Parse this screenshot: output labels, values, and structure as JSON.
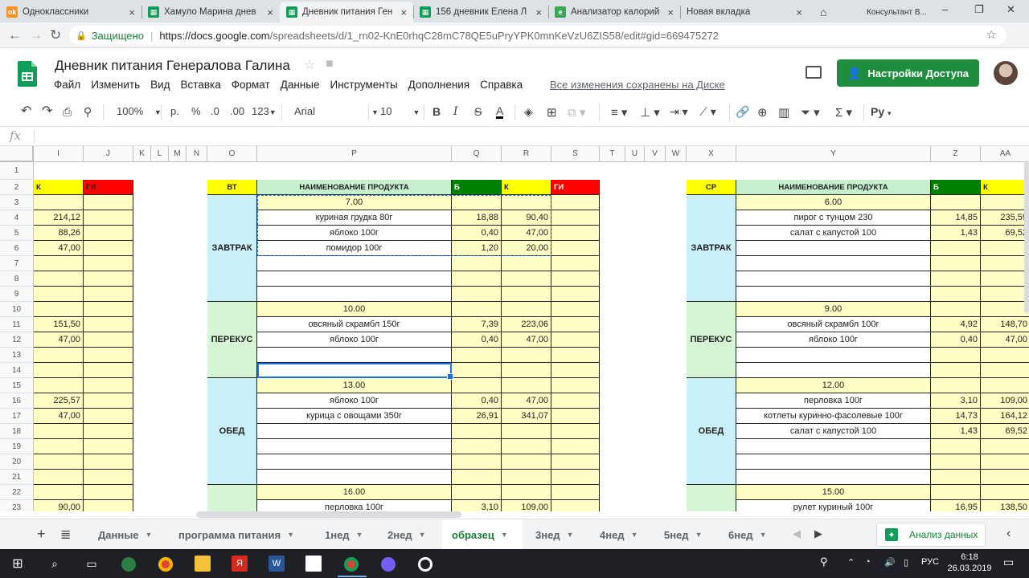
{
  "browser": {
    "tabs": [
      {
        "label": "Одноклассники",
        "icon": "ok-icon",
        "color": "#f7931e",
        "glyph": "ok"
      },
      {
        "label": "Хамуло Марина днев",
        "icon": "sheets-icon",
        "color": "#0f9d58",
        "glyph": "▦"
      },
      {
        "label": "Дневник питания Ген",
        "icon": "sheets-icon",
        "color": "#0f9d58",
        "glyph": "▦",
        "active": true
      },
      {
        "label": "156 дневник Елена Л",
        "icon": "sheets-icon",
        "color": "#0f9d58",
        "glyph": "▦"
      },
      {
        "label": "Анализатор калорий",
        "icon": "calorie-icon",
        "color": "#3aa757",
        "glyph": "e"
      },
      {
        "label": "Новая вкладка",
        "icon": "",
        "color": "",
        "glyph": ""
      }
    ],
    "extra_tab": "Консультант В...",
    "secure_label": "Защищено",
    "url_host": "https://docs.google.com",
    "url_path": "/spreadsheets/d/1_rn02-KnE0rhqC28mC78QE5uPryYPK0mnKeVzU6ZIS58/edit#gid=669475272"
  },
  "doc": {
    "title": "Дневник питания Генералова Галина",
    "menu": [
      "Файл",
      "Изменить",
      "Вид",
      "Вставка",
      "Формат",
      "Данные",
      "Инструменты",
      "Дополнения",
      "Справка"
    ],
    "saved": "Все изменения сохранены на Диске",
    "share": "Настройки Доступа"
  },
  "toolbar": {
    "zoom": "100%",
    "currency": "р.",
    "percent": "%",
    "dec_less": ".0",
    "dec_more": ".00",
    "format_more": "123",
    "font": "Arial",
    "size": "10",
    "bold": "B",
    "italic": "I",
    "strike": "S",
    "textcolor": "A",
    "input_tool": "Ру"
  },
  "grid": {
    "columns": [
      "I",
      "J",
      "K",
      "L",
      "M",
      "N",
      "O",
      "P",
      "Q",
      "R",
      "S",
      "T",
      "U",
      "V",
      "W",
      "X",
      "Y",
      "Z",
      "AA"
    ],
    "rows": [
      "1",
      "2",
      "3",
      "4",
      "5",
      "6",
      "7",
      "8",
      "9",
      "10",
      "11",
      "12",
      "13",
      "14",
      "15",
      "16",
      "17",
      "18",
      "19",
      "20",
      "21",
      "22",
      "23"
    ],
    "header_k": "К",
    "header_gi": "ГИ",
    "header_b": "Б",
    "product_header": "НАИМЕНОВАНИЕ ПРОДУКТА",
    "day1": "ВТ",
    "day2": "СР",
    "left_k": {
      "4": "214,12",
      "5": "88,26",
      "6": "47,00",
      "11": "151,50",
      "12": "47,00",
      "16": "225,57",
      "17": "47,00",
      "23": "90,00"
    },
    "meals": {
      "breakfast": "ЗАВТРАК",
      "snack": "ПЕРЕКУС",
      "lunch": "ОБЕД"
    },
    "day1_entries": [
      {
        "row": 3,
        "name": "7.00"
      },
      {
        "row": 4,
        "name": "куриная грудка 80г",
        "b": "18,88",
        "k": "90,40"
      },
      {
        "row": 5,
        "name": "яблоко 100г",
        "b": "0,40",
        "k": "47,00"
      },
      {
        "row": 6,
        "name": "помидор 100г",
        "b": "1,20",
        "k": "20,00"
      },
      {
        "row": 10,
        "name": "10.00"
      },
      {
        "row": 11,
        "name": "овсяный скрамбл 150г",
        "b": "7,39",
        "k": "223,06"
      },
      {
        "row": 12,
        "name": "яблоко 100г",
        "b": "0,40",
        "k": "47,00"
      },
      {
        "row": 15,
        "name": "13.00"
      },
      {
        "row": 16,
        "name": "яблоко 100г",
        "b": "0,40",
        "k": "47,00"
      },
      {
        "row": 17,
        "name": "курица с овощами 350г",
        "b": "26,91",
        "k": "341,07"
      },
      {
        "row": 22,
        "name": "16.00"
      },
      {
        "row": 23,
        "name": "перловка 100г",
        "b": "3,10",
        "k": "109,00"
      }
    ],
    "day2_entries": [
      {
        "row": 3,
        "name": "6.00"
      },
      {
        "row": 4,
        "name": "пирог с тунцом 230",
        "b": "14,85",
        "k": "235,59"
      },
      {
        "row": 5,
        "name": "салат с капустой 100",
        "b": "1,43",
        "k": "69,52"
      },
      {
        "row": 10,
        "name": "9.00"
      },
      {
        "row": 11,
        "name": "овсяный скрамбл 100г",
        "b": "4,92",
        "k": "148,70"
      },
      {
        "row": 12,
        "name": "яблоко 100г",
        "b": "0,40",
        "k": "47,00"
      },
      {
        "row": 15,
        "name": "12.00"
      },
      {
        "row": 16,
        "name": "перловка 100г",
        "b": "3,10",
        "k": "109,00"
      },
      {
        "row": 17,
        "name": "котлеты куринно-фасолевые 100г",
        "b": "14,73",
        "k": "164,12"
      },
      {
        "row": 18,
        "name": "салат с капустой 100",
        "b": "1,43",
        "k": "69,52"
      },
      {
        "row": 22,
        "name": "15.00"
      },
      {
        "row": 23,
        "name": "рулет куриный 100г",
        "b": "16,95",
        "k": "138,50"
      }
    ]
  },
  "colors": {
    "yellow": "#ffffc5",
    "header_yellow": "#ffff00",
    "header_red": "#ff0000",
    "header_green": "#008000",
    "header_lightgreen": "#c6efce",
    "meal_blue": "#c9f0f8",
    "meal_green": "#d5f5d5"
  },
  "sheets": {
    "tabs": [
      "Данные",
      "программа питания",
      "1нед",
      "2нед",
      "образец",
      "3нед",
      "4нед",
      "5нед",
      "6нед"
    ],
    "active": "образец",
    "explore": "Анализ данных"
  },
  "taskbar": {
    "lang": "РУС",
    "time": "6:18",
    "date": "26.03.2019"
  }
}
